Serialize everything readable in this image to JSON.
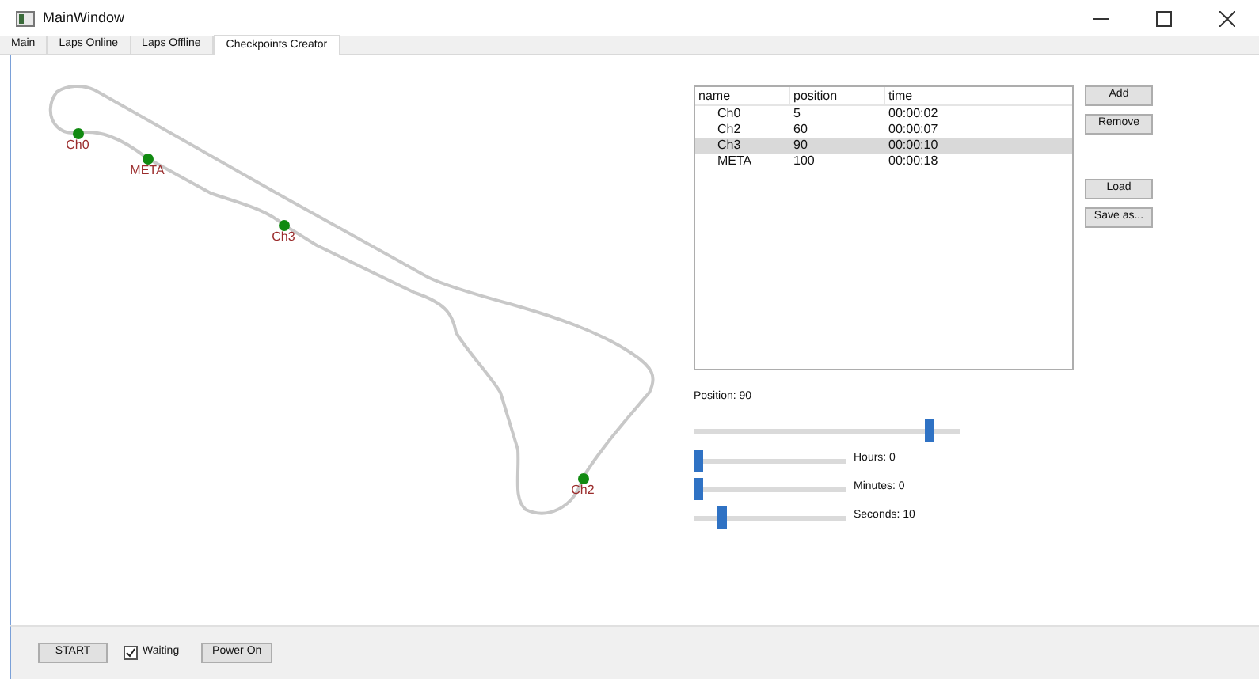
{
  "window": {
    "title": "MainWindow"
  },
  "tabs": [
    {
      "label": "Main",
      "selected": false
    },
    {
      "label": "Laps Online",
      "selected": false
    },
    {
      "label": "Laps Offline",
      "selected": false
    },
    {
      "label": "Checkpoints Creator",
      "selected": true
    }
  ],
  "track_markers": [
    {
      "label": "Ch0"
    },
    {
      "label": "META"
    },
    {
      "label": "Ch3"
    },
    {
      "label": "Ch2"
    }
  ],
  "table": {
    "columns": [
      "name",
      "position",
      "time"
    ],
    "rows": [
      {
        "cells": [
          "Ch0",
          "5",
          "00:00:02"
        ],
        "selected": false
      },
      {
        "cells": [
          "Ch2",
          "60",
          "00:00:07"
        ],
        "selected": false
      },
      {
        "cells": [
          "Ch3",
          "90",
          "00:00:10"
        ],
        "selected": true
      },
      {
        "cells": [
          "META",
          "100",
          "00:00:18"
        ],
        "selected": false
      }
    ]
  },
  "side_buttons": [
    {
      "label": "Add"
    },
    {
      "label": "Remove"
    },
    {
      "label": "Load"
    },
    {
      "label": "Save as..."
    }
  ],
  "position": {
    "label": "Position: 90",
    "level": 0.9
  },
  "time_sliders": [
    {
      "label": "Hours: 0",
      "level": 0
    },
    {
      "label": "Minutes: 0",
      "level": 0
    },
    {
      "label": "Seconds: 10",
      "level": 0.17
    }
  ],
  "bottom": {
    "start": "START",
    "waiting": {
      "label": "Waiting",
      "checked": true
    },
    "power": "Power On"
  }
}
